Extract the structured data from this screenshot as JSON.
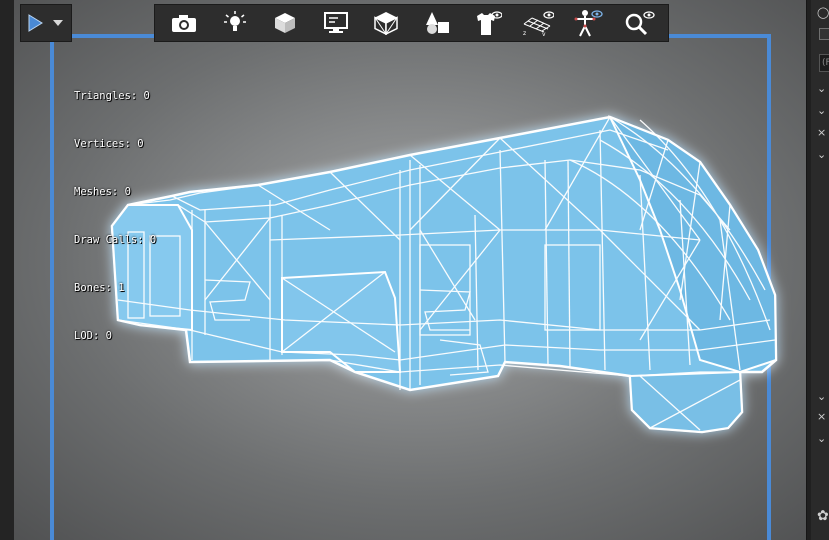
{
  "stats": {
    "triangles": "Triangles: 0",
    "vertices": "Vertices: 0",
    "meshes": "Meshes: 0",
    "draw_calls": "Draw Calls: 0",
    "bones": "Bones: 1",
    "lod": "LOD: 0"
  },
  "toolbar": {
    "icons": [
      "camera-icon",
      "light-icon",
      "cube-icon",
      "display-icon",
      "wireframe-cube-icon",
      "shapes-icon",
      "tshirt-visibility-icon",
      "grid-visibility-icon",
      "skeleton-visibility-icon",
      "search-visibility-icon"
    ]
  },
  "right_panel": {
    "field_text": "(F"
  },
  "colors": {
    "accent": "#4a8ad6",
    "wire": "#ffffff",
    "fill": "#7cc3ea"
  }
}
